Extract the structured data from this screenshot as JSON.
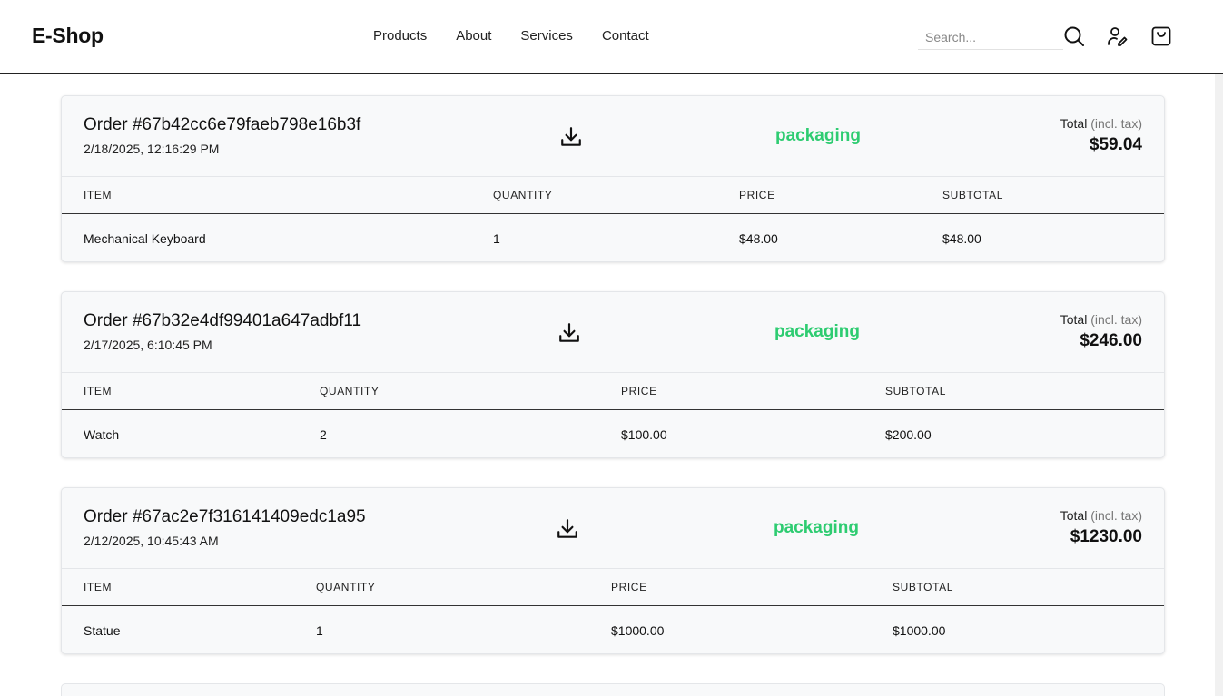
{
  "header": {
    "logo": "E-Shop",
    "nav": [
      "Products",
      "About",
      "Services",
      "Contact"
    ],
    "search_placeholder": "Search...",
    "icons": [
      "search-icon",
      "user-edit-icon",
      "shopping-bag-icon"
    ]
  },
  "table_headers": [
    "ITEM",
    "QUANTITY",
    "PRICE",
    "SUBTOTAL"
  ],
  "total_label": "Total",
  "total_suffix": "(incl. tax)",
  "status_color": "#2ecc71",
  "orders": [
    {
      "title": "Order #67b42cc6e79faeb798e16b3f",
      "date": "2/18/2025, 12:16:29 PM",
      "status": "packaging",
      "total": "$59.04",
      "items": [
        {
          "name": "Mechanical Keyboard",
          "quantity": "1",
          "price": "$48.00",
          "subtotal": "$48.00"
        }
      ]
    },
    {
      "title": "Order #67b32e4df99401a647adbf11",
      "date": "2/17/2025, 6:10:45 PM",
      "status": "packaging",
      "total": "$246.00",
      "items": [
        {
          "name": "Watch",
          "quantity": "2",
          "price": "$100.00",
          "subtotal": "$200.00"
        }
      ]
    },
    {
      "title": "Order #67ac2e7f316141409edc1a95",
      "date": "2/12/2025, 10:45:43 AM",
      "status": "packaging",
      "total": "$1230.00",
      "items": [
        {
          "name": "Statue",
          "quantity": "1",
          "price": "$1000.00",
          "subtotal": "$1000.00"
        }
      ]
    }
  ]
}
